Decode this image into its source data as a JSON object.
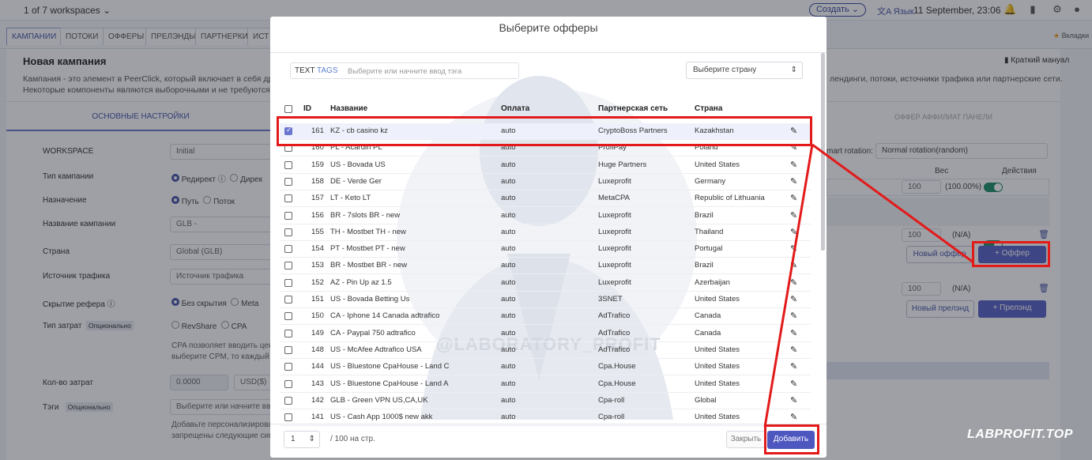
{
  "topbar": {
    "workspaces": "1 of 7 workspaces",
    "create": "Создать",
    "language": "Язык",
    "datetime": "11 September, 23:06"
  },
  "tabs": [
    "КАМПАНИИ",
    "ПОТОКИ",
    "ОФФЕРЫ",
    "ПРЕЛЭНДЫ",
    "ПАРТНЕРКИ",
    "ИСТ"
  ],
  "bookmarks": "Вкладки",
  "page": {
    "title": "Новая кампания",
    "desc1": "Кампания - это элемент в PeerClick, который включает в себя други",
    "desc2": "Некоторые компоненты являются выборочными и не требуются д",
    "desc_right": "лендинги, потоки, источники трафика или партнерские сети.",
    "manual": "Краткий мануал",
    "subtab_main": "ОСНОВНЫЕ НАСТРОЙКИ",
    "subtab_offer": "ОФФЕР АФФИЛИАТ ПАНЕЛИ"
  },
  "form": {
    "workspace_label": "WORKSPACE",
    "workspace_value": "Initial",
    "type_label": "Тип кампании",
    "type_opt1": "Редирект",
    "type_opt2": "Дирек",
    "dest_label": "Назначение",
    "dest_opt1": "Путь",
    "dest_opt2": "Поток",
    "name_label": "Название кампании",
    "name_value": "GLB -",
    "country_label": "Страна",
    "country_value": "Global (GLB)",
    "source_label": "Источник трафика",
    "source_value": "Источник трафика",
    "ref_label": "Скрытие рефера",
    "ref_opt1": "Без скрытия",
    "ref_opt2": "Meta",
    "cost_type_label": "Тип затрат",
    "optional": "Опционально",
    "cost_opt1": "RevShare",
    "cost_opt2": "CPA",
    "cost_help1": "CPA позволяет вводить цен",
    "cost_help2": "выберите CPM, то каждый",
    "cost_amount_label": "Кол-во затрат",
    "cost_amount_value": "0.0000",
    "currency": "USD($)",
    "tags_label": "Тэги",
    "tags_placeholder": "Выберите или начните ввод",
    "pers1": "Добавьте персонализирова",
    "pers2": "запрещены следующие сим"
  },
  "right": {
    "rotation_label": "mart rotation:",
    "rotation_value": "Normal rotation(random)",
    "weight_header": "Вес",
    "actions_header": "Действия",
    "w1": "100",
    "pct1": "(100.00%)",
    "w2": "100",
    "na2": "(N/A)",
    "w3": "100",
    "na3": "(N/A)",
    "new_offer": "Новый оффер",
    "add_offer": "+ Оффер",
    "new_prelend": "Новый прелэнд",
    "add_prelend": "+ Прелэнд"
  },
  "modal": {
    "title": "Выберите офферы",
    "filter_text": "TEXT",
    "filter_tags": "TAGS",
    "filter_placeholder": "Выберите или начните ввод тэга",
    "country_select": "Выберите страну",
    "columns": {
      "id": "ID",
      "name": "Название",
      "payout": "Оплата",
      "network": "Партнерская сеть",
      "country": "Страна"
    },
    "rows": [
      {
        "id": "161",
        "name": "KZ - cb casino kz",
        "payout": "auto",
        "network": "CryptoBoss Partners",
        "country": "Kazakhstan",
        "checked": true
      },
      {
        "id": "160",
        "name": "PL - Acardin PL",
        "payout": "auto",
        "network": "ProfiPay",
        "country": "Poland"
      },
      {
        "id": "159",
        "name": "US - Bovada US",
        "payout": "auto",
        "network": "Huge Partners",
        "country": "United States"
      },
      {
        "id": "158",
        "name": "DE - Verde Ger",
        "payout": "auto",
        "network": "Luxeprofit",
        "country": "Germany"
      },
      {
        "id": "157",
        "name": "LT - Keto LT",
        "payout": "auto",
        "network": "MetaCPA",
        "country": "Republic of Lithuania"
      },
      {
        "id": "156",
        "name": "BR - 7slots BR - new",
        "payout": "auto",
        "network": "Luxeprofit",
        "country": "Brazil"
      },
      {
        "id": "155",
        "name": "TH - Mostbet TH - new",
        "payout": "auto",
        "network": "Luxeprofit",
        "country": "Thailand"
      },
      {
        "id": "154",
        "name": "PT - Mostbet PT - new",
        "payout": "auto",
        "network": "Luxeprofit",
        "country": "Portugal"
      },
      {
        "id": "153",
        "name": "BR - Mostbet BR - new",
        "payout": "auto",
        "network": "Luxeprofit",
        "country": "Brazil"
      },
      {
        "id": "152",
        "name": "AZ - Pin Up az 1.5",
        "payout": "auto",
        "network": "Luxeprofit",
        "country": "Azerbaijan"
      },
      {
        "id": "151",
        "name": "US - Bovada Betting Us",
        "payout": "auto",
        "network": "3SNET",
        "country": "United States"
      },
      {
        "id": "150",
        "name": "CA - Iphone 14 Canada adtrafico",
        "payout": "auto",
        "network": "AdTrafico",
        "country": "Canada"
      },
      {
        "id": "149",
        "name": "CA - Paypal 750 adtrafico",
        "payout": "auto",
        "network": "AdTrafico",
        "country": "Canada"
      },
      {
        "id": "148",
        "name": "US - McAfee Adtrafico USA",
        "payout": "auto",
        "network": "AdTrafico",
        "country": "United States"
      },
      {
        "id": "144",
        "name": "US - Bluestone CpaHouse - Land C",
        "payout": "auto",
        "network": "Cpa.House",
        "country": "United States"
      },
      {
        "id": "143",
        "name": "US - Bluestone CpaHouse - Land A",
        "payout": "auto",
        "network": "Cpa.House",
        "country": "United States"
      },
      {
        "id": "142",
        "name": "GLB - Green VPN US,CA,UK",
        "payout": "auto",
        "network": "Cpa-roll",
        "country": "Global"
      },
      {
        "id": "141",
        "name": "US - Cash App 1000$ new akk",
        "payout": "auto",
        "network": "Cpa-roll",
        "country": "United States"
      }
    ],
    "per_page": "1",
    "per_page_label": "/ 100 на стр.",
    "close": "Закрыть",
    "add": "Добавить"
  },
  "watermark_text": "@LABORATORY_PROFIT",
  "brand": "LABPROFIT.TOP"
}
